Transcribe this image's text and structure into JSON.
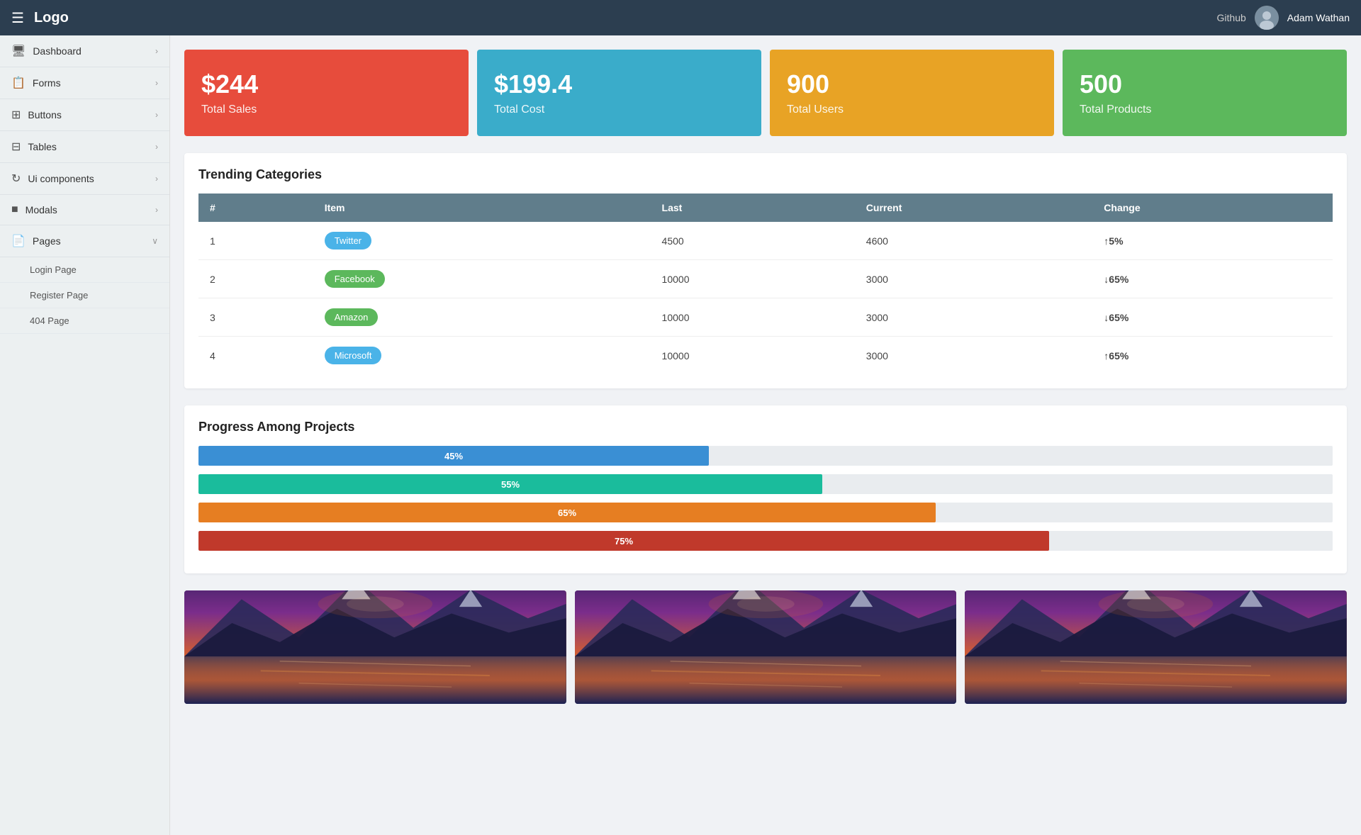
{
  "topnav": {
    "hamburger": "☰",
    "logo": "Logo",
    "github": "Github",
    "user_name": "Adam Wathan",
    "avatar_symbol": "👤"
  },
  "sidebar": {
    "items": [
      {
        "id": "dashboard",
        "label": "Dashboard",
        "icon": "🖥",
        "has_sub": false,
        "chevron": "›"
      },
      {
        "id": "forms",
        "label": "Forms",
        "icon": "📋",
        "has_sub": false,
        "chevron": "›"
      },
      {
        "id": "buttons",
        "label": "Buttons",
        "icon": "⊞",
        "has_sub": false,
        "chevron": "›"
      },
      {
        "id": "tables",
        "label": "Tables",
        "icon": "⊟",
        "has_sub": false,
        "chevron": "›"
      },
      {
        "id": "ui-components",
        "label": "Ui components",
        "icon": "↻",
        "has_sub": false,
        "chevron": "›"
      },
      {
        "id": "modals",
        "label": "Modals",
        "icon": "■",
        "has_sub": false,
        "chevron": "›"
      },
      {
        "id": "pages",
        "label": "Pages",
        "icon": "📄",
        "has_sub": true,
        "chevron": "∨"
      }
    ],
    "sub_items": [
      {
        "id": "login-page",
        "label": "Login Page",
        "chevron": "›"
      },
      {
        "id": "register-page",
        "label": "Register Page",
        "chevron": ""
      },
      {
        "id": "404-page",
        "label": "404 Page",
        "chevron": "›"
      }
    ]
  },
  "stat_cards": [
    {
      "id": "total-sales",
      "value": "$244",
      "label": "Total Sales",
      "color_class": "card-red"
    },
    {
      "id": "total-cost",
      "value": "$199.4",
      "label": "Total Cost",
      "color_class": "card-blue"
    },
    {
      "id": "total-users",
      "value": "900",
      "label": "Total Users",
      "color_class": "card-orange"
    },
    {
      "id": "total-products",
      "value": "500",
      "label": "Total Products",
      "color_class": "card-green"
    }
  ],
  "trending_categories": {
    "title": "Trending Categories",
    "columns": [
      "#",
      "Item",
      "Last",
      "Current",
      "Change"
    ],
    "rows": [
      {
        "num": "1",
        "item": "Twitter",
        "badge_class": "badge-twitter",
        "last": "4500",
        "current": "4600",
        "change": "5%",
        "direction": "up"
      },
      {
        "num": "2",
        "item": "Facebook",
        "badge_class": "badge-facebook",
        "last": "10000",
        "current": "3000",
        "change": "65%",
        "direction": "down"
      },
      {
        "num": "3",
        "item": "Amazon",
        "badge_class": "badge-amazon",
        "last": "10000",
        "current": "3000",
        "change": "65%",
        "direction": "down"
      },
      {
        "num": "4",
        "item": "Microsoft",
        "badge_class": "badge-microsoft",
        "last": "10000",
        "current": "3000",
        "change": "65%",
        "direction": "up"
      }
    ]
  },
  "progress_section": {
    "title": "Progress Among Projects",
    "bars": [
      {
        "id": "bar1",
        "percent": 45,
        "label": "45%",
        "color_class": "bar-blue"
      },
      {
        "id": "bar2",
        "percent": 55,
        "label": "55%",
        "color_class": "bar-teal"
      },
      {
        "id": "bar3",
        "percent": 65,
        "label": "65%",
        "color_class": "bar-orange"
      },
      {
        "id": "bar4",
        "percent": 75,
        "label": "75%",
        "color_class": "bar-red"
      }
    ]
  },
  "image_section": {
    "images": [
      {
        "id": "img1",
        "alt": "Mountain landscape 1"
      },
      {
        "id": "img2",
        "alt": "Mountain landscape 2"
      },
      {
        "id": "img3",
        "alt": "Mountain landscape 3"
      }
    ]
  }
}
